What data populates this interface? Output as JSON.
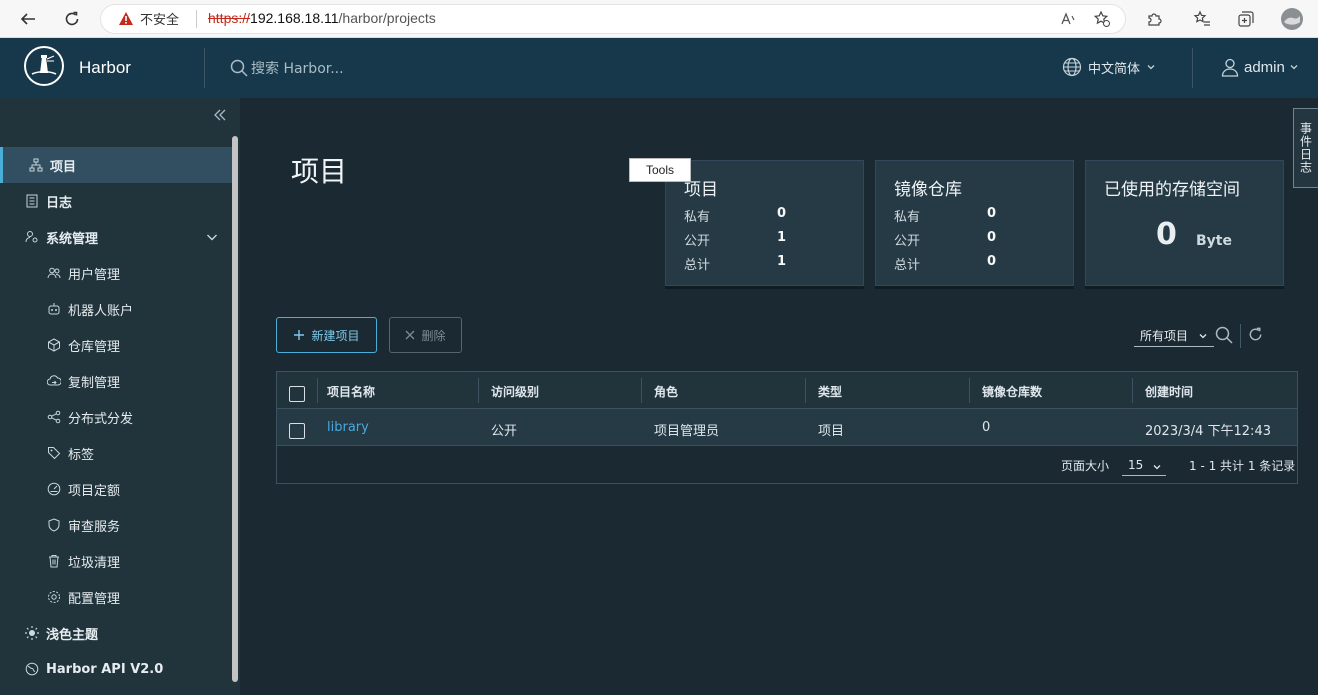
{
  "browser": {
    "security_label": "不安全",
    "url_scheme": "https://",
    "url_host": "192.168.18.11",
    "url_path": "/harbor/projects"
  },
  "header": {
    "brand": "Harbor",
    "search_placeholder": "搜索 Harbor...",
    "language": "中文简体",
    "user": "admin"
  },
  "sidebar": {
    "items": [
      {
        "label": "项目",
        "icon": "projects-icon",
        "active": true
      },
      {
        "label": "日志",
        "icon": "logs-icon"
      },
      {
        "label": "系统管理",
        "icon": "admin-icon"
      },
      {
        "label": "用户管理",
        "icon": "users-icon"
      },
      {
        "label": "机器人账户",
        "icon": "robot-icon"
      },
      {
        "label": "仓库管理",
        "icon": "registry-icon"
      },
      {
        "label": "复制管理",
        "icon": "replication-icon"
      },
      {
        "label": "分布式分发",
        "icon": "distribution-icon"
      },
      {
        "label": "标签",
        "icon": "tag-icon"
      },
      {
        "label": "项目定额",
        "icon": "quota-icon"
      },
      {
        "label": "审查服务",
        "icon": "shield-icon"
      },
      {
        "label": "垃圾清理",
        "icon": "trash-icon"
      },
      {
        "label": "配置管理",
        "icon": "gear-icon"
      }
    ],
    "theme": "浅色主题",
    "api": "Harbor API V2.0"
  },
  "main": {
    "title": "项目",
    "tooltip": "Tools",
    "cards": {
      "projects": {
        "title": "项目",
        "private_label": "私有",
        "private": "0",
        "public_label": "公开",
        "public": "1",
        "total_label": "总计",
        "total": "1"
      },
      "repos": {
        "title": "镜像仓库",
        "private_label": "私有",
        "private": "0",
        "public_label": "公开",
        "public": "0",
        "total_label": "总计",
        "total": "0"
      },
      "storage": {
        "title": "已使用的存储空间",
        "value": "0",
        "unit": "Byte"
      }
    },
    "buttons": {
      "new_project": "新建项目",
      "delete": "删除"
    },
    "filter": "所有项目",
    "table": {
      "headers": [
        "项目名称",
        "访问级别",
        "角色",
        "类型",
        "镜像仓库数",
        "创建时间"
      ],
      "rows": [
        {
          "name": "library",
          "access": "公开",
          "role": "项目管理员",
          "type": "项目",
          "repo_count": "0",
          "created": "2023/3/4 下午12:43"
        }
      ],
      "page_size_label": "页面大小",
      "page_size": "15",
      "summary": "1 - 1 共计 1 条记录"
    },
    "side_tab": "事件日志"
  },
  "colors": {
    "header_bg": "#17384a",
    "sidebar_bg": "#21333b",
    "main_bg": "#1b2a32",
    "accent": "#4aaed9"
  }
}
